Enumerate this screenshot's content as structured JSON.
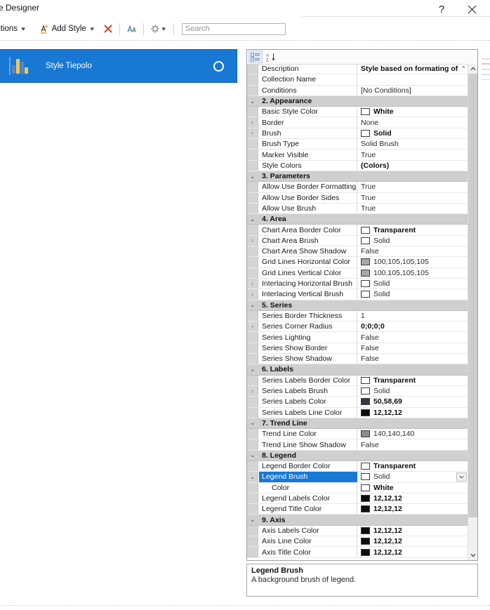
{
  "window": {
    "title": "tyle Designer",
    "help_button": "?",
    "close_button": "✕"
  },
  "toolbar": {
    "actions_label": "ctions",
    "add_style_label": "Add Style",
    "delete_icon": "delete-x-icon",
    "font_icon": "font-icon",
    "settings_icon": "gear-icon",
    "search_placeholder": "Search",
    "search_value": ""
  },
  "styles_list": {
    "items": [
      {
        "name": "Style Tiepolo",
        "selected": true,
        "icon": "bar-chart-icon",
        "radio": "selected-radio-icon"
      }
    ]
  },
  "property_grid": {
    "toolbar": {
      "categorized_icon": "categorized-view-icon",
      "alphabetical_icon": "alphabetical-sort-icon"
    },
    "rows": [
      {
        "type": "prop",
        "name": "Description",
        "value": "Style based on formating of",
        "bold": true,
        "expander": "",
        "swatch": null
      },
      {
        "type": "prop",
        "name": "Collection Name",
        "value": "",
        "bold": false,
        "expander": "",
        "swatch": null
      },
      {
        "type": "prop",
        "name": "Conditions",
        "value": "[No Conditions]",
        "bold": false,
        "expander": "",
        "swatch": null
      },
      {
        "type": "category",
        "name": "2. Appearance",
        "expander": "expanded"
      },
      {
        "type": "prop",
        "name": "Basic Style Color",
        "value": "White",
        "bold": true,
        "expander": "",
        "swatch": "#ffffff"
      },
      {
        "type": "prop",
        "name": "Border",
        "value": "None",
        "bold": false,
        "expander": "collapsed",
        "swatch": null
      },
      {
        "type": "prop",
        "name": "Brush",
        "value": "Solid",
        "bold": true,
        "expander": "collapsed",
        "swatch": "#ffffff"
      },
      {
        "type": "prop",
        "name": "Brush Type",
        "value": "Solid Brush",
        "bold": false,
        "expander": "",
        "swatch": null
      },
      {
        "type": "prop",
        "name": "Marker Visible",
        "value": "True",
        "bold": false,
        "expander": "",
        "swatch": null
      },
      {
        "type": "prop",
        "name": "Style Colors",
        "value": "(Colors)",
        "bold": true,
        "expander": "",
        "swatch": null
      },
      {
        "type": "category",
        "name": "3. Parameters",
        "expander": "expanded"
      },
      {
        "type": "prop",
        "name": "Allow Use Border Formatting",
        "value": "True",
        "bold": false,
        "expander": "",
        "swatch": null
      },
      {
        "type": "prop",
        "name": "Allow Use Border Sides",
        "value": "True",
        "bold": false,
        "expander": "",
        "swatch": null
      },
      {
        "type": "prop",
        "name": "Allow Use Brush",
        "value": "True",
        "bold": false,
        "expander": "",
        "swatch": null
      },
      {
        "type": "category",
        "name": "4. Area",
        "expander": "expanded"
      },
      {
        "type": "prop",
        "name": "Chart Area Border Color",
        "value": "Transparent",
        "bold": true,
        "expander": "",
        "swatch": "#ffffff"
      },
      {
        "type": "prop",
        "name": "Chart Area Brush",
        "value": "Solid",
        "bold": false,
        "expander": "collapsed",
        "swatch": "#ffffff"
      },
      {
        "type": "prop",
        "name": "Chart Area Show Shadow",
        "value": "False",
        "bold": false,
        "expander": "",
        "swatch": null
      },
      {
        "type": "prop",
        "name": "Grid Lines Horizontal Color",
        "value": "100,105,105,105",
        "bold": false,
        "expander": "",
        "swatch": "#a8a8a8"
      },
      {
        "type": "prop",
        "name": "Grid Lines Vertical Color",
        "value": "100,105,105,105",
        "bold": false,
        "expander": "",
        "swatch": "#a8a8a8"
      },
      {
        "type": "prop",
        "name": "Interlacing Horizontal Brush",
        "value": "Solid",
        "bold": false,
        "expander": "collapsed",
        "swatch": "#ffffff"
      },
      {
        "type": "prop",
        "name": "Interlacing Vertical Brush",
        "value": "Solid",
        "bold": false,
        "expander": "collapsed",
        "swatch": "#ffffff"
      },
      {
        "type": "category",
        "name": "5. Series",
        "expander": "expanded"
      },
      {
        "type": "prop",
        "name": "Series Border Thickness",
        "value": "1",
        "bold": false,
        "expander": "",
        "swatch": null
      },
      {
        "type": "prop",
        "name": "Series Corner Radius",
        "value": "0;0;0;0",
        "bold": true,
        "expander": "collapsed",
        "swatch": null
      },
      {
        "type": "prop",
        "name": "Series Lighting",
        "value": "False",
        "bold": false,
        "expander": "",
        "swatch": null
      },
      {
        "type": "prop",
        "name": "Series Show Border",
        "value": "False",
        "bold": false,
        "expander": "",
        "swatch": null
      },
      {
        "type": "prop",
        "name": "Series Show Shadow",
        "value": "False",
        "bold": false,
        "expander": "",
        "swatch": null
      },
      {
        "type": "category",
        "name": "6. Labels",
        "expander": "expanded"
      },
      {
        "type": "prop",
        "name": "Series Labels Border Color",
        "value": "Transparent",
        "bold": true,
        "expander": "",
        "swatch": "#ffffff"
      },
      {
        "type": "prop",
        "name": "Series Labels Brush",
        "value": "Solid",
        "bold": false,
        "expander": "collapsed",
        "swatch": "#ffffff"
      },
      {
        "type": "prop",
        "name": "Series Labels Color",
        "value": "50,58,69",
        "bold": true,
        "expander": "",
        "swatch": "#323a45"
      },
      {
        "type": "prop",
        "name": "Series Labels Line Color",
        "value": "12,12,12",
        "bold": true,
        "expander": "",
        "swatch": "#0c0c0c"
      },
      {
        "type": "category",
        "name": "7. Trend  Line",
        "expander": "expanded"
      },
      {
        "type": "prop",
        "name": "Trend Line Color",
        "value": "140,140,140",
        "bold": false,
        "expander": "",
        "swatch": "#8c8c8c"
      },
      {
        "type": "prop",
        "name": "Trend Line Show Shadow",
        "value": "False",
        "bold": false,
        "expander": "",
        "swatch": null
      },
      {
        "type": "category",
        "name": "8. Legend",
        "expander": "expanded"
      },
      {
        "type": "prop",
        "name": "Legend Border Color",
        "value": "Transparent",
        "bold": true,
        "expander": "",
        "swatch": "#ffffff"
      },
      {
        "type": "prop",
        "name": "Legend Brush",
        "value": "Solid",
        "bold": false,
        "expander": "expanded",
        "swatch": "#ffffff",
        "selected": true,
        "dropdown": true
      },
      {
        "type": "prop",
        "name": "Color",
        "value": "White",
        "bold": true,
        "expander": "",
        "swatch": "#ffffff",
        "sub": true
      },
      {
        "type": "prop",
        "name": "Legend Labels Color",
        "value": "12,12,12",
        "bold": true,
        "expander": "",
        "swatch": "#0c0c0c"
      },
      {
        "type": "prop",
        "name": "Legend Title Color",
        "value": "12,12,12",
        "bold": true,
        "expander": "",
        "swatch": "#0c0c0c"
      },
      {
        "type": "category",
        "name": "9. Axis",
        "expander": "expanded"
      },
      {
        "type": "prop",
        "name": "Axis Labels Color",
        "value": "12,12,12",
        "bold": true,
        "expander": "",
        "swatch": "#0c0c0c"
      },
      {
        "type": "prop",
        "name": "Axis Line Color",
        "value": "12,12,12",
        "bold": true,
        "expander": "",
        "swatch": "#0c0c0c"
      },
      {
        "type": "prop",
        "name": "Axis Title Color",
        "value": "12,12,12",
        "bold": true,
        "expander": "",
        "swatch": "#0c0c0c"
      }
    ]
  },
  "description_panel": {
    "title": "Legend Brush",
    "text": "A background brush of legend."
  },
  "colors": {
    "accent": "#1878d4",
    "category_bg": "#cfcfcf",
    "gutter_bg": "#d4d4d4",
    "panel_border": "#a0a0a0"
  }
}
